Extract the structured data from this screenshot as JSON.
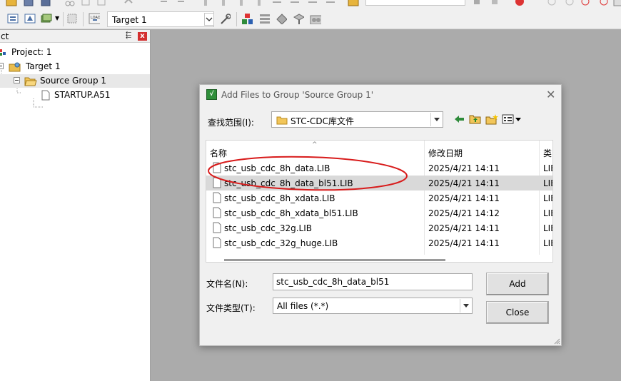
{
  "toolbar": {
    "target_value": "Target 1",
    "accent_color": "#f0f0f0"
  },
  "project_panel": {
    "title": "ct",
    "pin_glyph": "⬱",
    "close_glyph": "x",
    "tree": [
      {
        "label": "Project: 1"
      },
      {
        "label": "Target 1"
      },
      {
        "label": "Source Group 1"
      },
      {
        "label": "STARTUP.A51"
      }
    ]
  },
  "dialog": {
    "title": "Add Files to Group 'Source Group 1'",
    "icon_text": "√",
    "close_glyph": "✕",
    "lookin_label": "查找范围(I):",
    "lookin_value": "STC-CDC库文件",
    "columns": {
      "name": "名称",
      "date": "修改日期",
      "type": "类"
    },
    "sort_glyph": "^",
    "files": [
      {
        "name": "stc_usb_cdc_8h_data.LIB",
        "date": "2025/4/21 14:11",
        "type": "LIE",
        "selected": false
      },
      {
        "name": "stc_usb_cdc_8h_data_bl51.LIB",
        "date": "2025/4/21 14:11",
        "type": "LIE",
        "selected": true
      },
      {
        "name": "stc_usb_cdc_8h_xdata.LIB",
        "date": "2025/4/21 14:11",
        "type": "LIE",
        "selected": false
      },
      {
        "name": "stc_usb_cdc_8h_xdata_bl51.LIB",
        "date": "2025/4/21 14:12",
        "type": "LIE",
        "selected": false
      },
      {
        "name": "stc_usb_cdc_32g.LIB",
        "date": "2025/4/21 14:11",
        "type": "LIE",
        "selected": false
      },
      {
        "name": "stc_usb_cdc_32g_huge.LIB",
        "date": "2025/4/21 14:11",
        "type": "LIE",
        "selected": false
      }
    ],
    "filename_label": "文件名(N):",
    "filename_value": "stc_usb_cdc_8h_data_bl51",
    "filetype_label": "文件类型(T):",
    "filetype_value": "All files (*.*)",
    "add_label": "Add",
    "close_label": "Close"
  },
  "annotation_color": "#d81b1b"
}
